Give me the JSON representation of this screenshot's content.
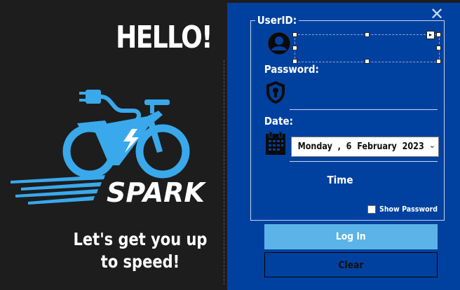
{
  "left": {
    "greeting": "HELLO!",
    "brand": "SPARK",
    "tagline_line1": "Let's get you up",
    "tagline_line2": "to speed!"
  },
  "form": {
    "userid_label": "UserID:",
    "userid_value": "",
    "password_label": "Password:",
    "password_value": "",
    "date_label": "Date:",
    "date_value": "Monday  ,  6  February  2023",
    "time_label": "Time",
    "show_password_label": "Show Password",
    "show_password_checked": false,
    "login_button": "Log In",
    "clear_button": "Clear",
    "close_symbol": "✕"
  },
  "icons": {
    "userid": "user-icon",
    "password": "lock-shield-icon",
    "date": "calendar-icon",
    "logo": "electric-bike-logo"
  },
  "colors": {
    "panel": "#0041a0",
    "accent": "#39a9ec",
    "login_button": "#5cb3e8",
    "background": "#1d1d1d"
  }
}
